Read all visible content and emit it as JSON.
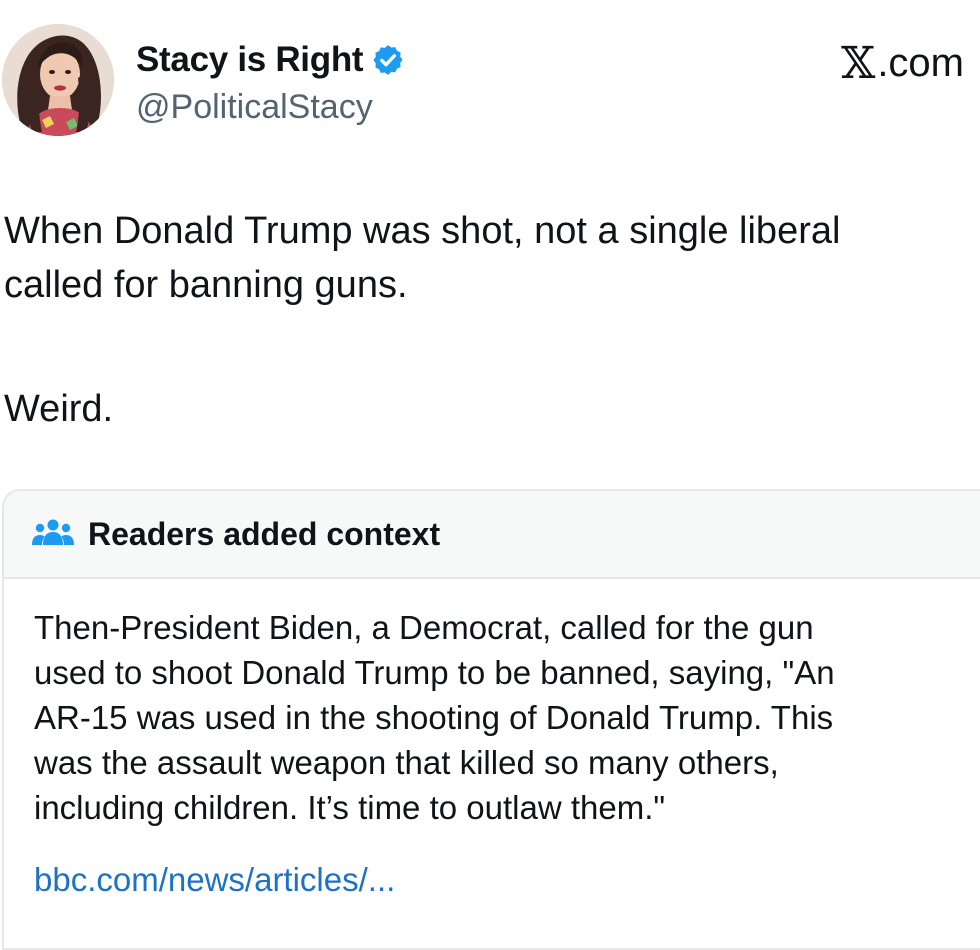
{
  "header": {
    "display_name": "Stacy is Right",
    "handle": "@PoliticalStacy",
    "brand": ".com",
    "brand_mark": "𝕏",
    "verified_color": "#1d9bf0",
    "verified_icon": "verified-badge-icon",
    "avatar_icon": "profile-photo"
  },
  "tweet": {
    "lines": [
      "When Donald Trump was shot, not a single liberal",
      "called for banning guns."
    ],
    "closing": "Weird."
  },
  "community_note": {
    "title": "Readers added context",
    "icon": "people-group-icon",
    "icon_color": "#1d9bf0",
    "lines": [
      "Then-President Biden, a Democrat, called for the gun",
      "used to shoot Donald Trump to be banned, saying, \"An",
      "AR-15 was used in the shooting of Donald Trump. This",
      "was the assault weapon that killed so many others,",
      "including children. It’s time to outlaw them.\""
    ],
    "link": "bbc.com/news/articles/...",
    "link_color": "#1d72c7"
  }
}
